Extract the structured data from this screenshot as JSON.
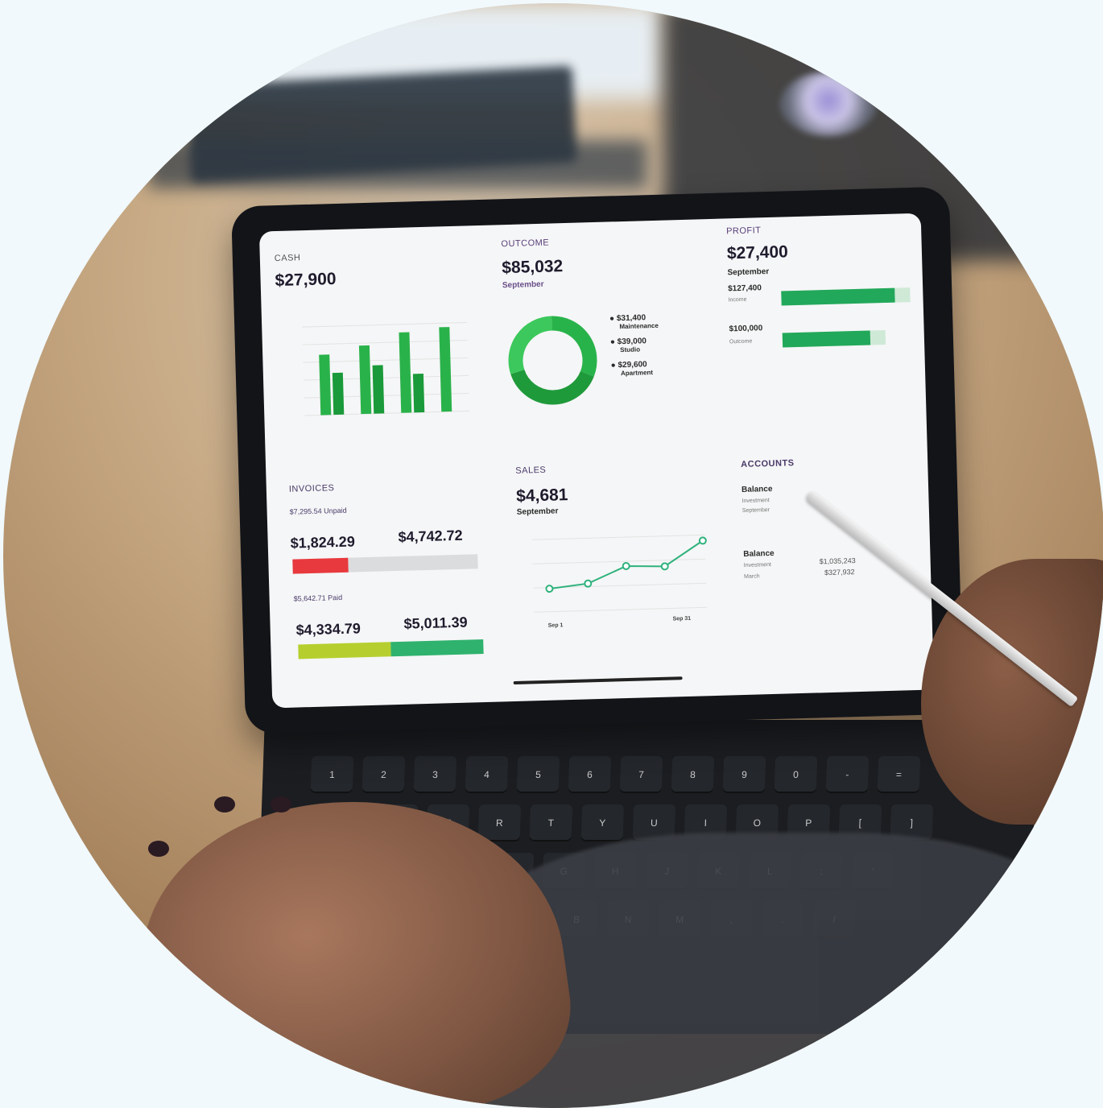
{
  "dashboard": {
    "cash": {
      "label": "CASH",
      "value": "$27,900"
    },
    "outcome": {
      "label": "OUTCOME",
      "value": "$85,032",
      "period": "September",
      "legend": [
        {
          "value": "$31,400",
          "name": "Maintenance"
        },
        {
          "value": "$39,000",
          "name": "Studio"
        },
        {
          "value": "$29,600",
          "name": "Apartment"
        }
      ]
    },
    "profit": {
      "label": "PROFIT",
      "value": "$27,400",
      "period": "September",
      "income_value": "$127,400",
      "income_label": "Income",
      "income_fill": 0.88,
      "outcome_value": "$100,000",
      "outcome_label": "Outcome",
      "outcome_fill": 0.85
    },
    "invoices": {
      "label": "INVOICES",
      "unpaid": "$7,295.54 Unpaid",
      "unpaid_a": "$1,824.29",
      "unpaid_b": "$4,742.72",
      "paid": "$5,642.71 Paid",
      "paid_a": "$4,334.79",
      "paid_b": "$5,011.39"
    },
    "sales": {
      "label": "SALES",
      "value": "$4,681",
      "period": "September",
      "x_start": "Sep 1",
      "x_end": "Sep 31"
    },
    "accounts": {
      "label": "ACCOUNTS",
      "balance1_label": "Balance",
      "balance1_rows": [
        "Investment",
        "September"
      ],
      "balance2_label": "Balance",
      "balance2_rows": [
        "Investment",
        "March"
      ],
      "balance2_values": [
        "$1,035,243",
        "$327,932"
      ]
    }
  },
  "colors": {
    "green": "#2ab24a",
    "dark_green": "#1a9a3a",
    "red": "#e8393e",
    "lime": "#b6cf2e",
    "teal": "#2fb26d"
  },
  "chart_data": [
    {
      "type": "bar",
      "categories": [
        "",
        "",
        "",
        ""
      ],
      "series": [
        {
          "values": [
            75,
            85,
            100,
            105
          ]
        },
        {
          "values": [
            52,
            60,
            48,
            0
          ]
        }
      ]
    },
    {
      "type": "pie",
      "labels": [
        "Maintenance",
        "Studio",
        "Apartment"
      ],
      "values": [
        31400,
        39000,
        29600
      ]
    },
    {
      "type": "line",
      "x": [
        "Sep 1",
        "",
        "",
        "",
        "Sep 31"
      ],
      "values": [
        18,
        21,
        33,
        32,
        50
      ]
    }
  ]
}
